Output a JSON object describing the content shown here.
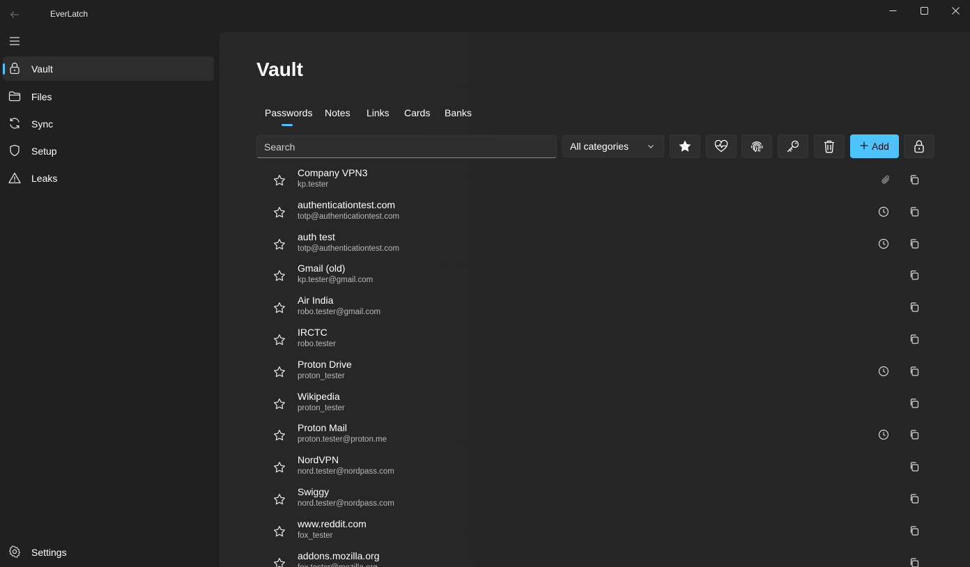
{
  "app": {
    "title": "EverLatch"
  },
  "sidebar": {
    "items": [
      {
        "label": "Vault",
        "icon": "lock-icon",
        "active": true
      },
      {
        "label": "Files",
        "icon": "folder-icon",
        "active": false
      },
      {
        "label": "Sync",
        "icon": "sync-icon",
        "active": false
      },
      {
        "label": "Setup",
        "icon": "shield-icon",
        "active": false
      },
      {
        "label": "Leaks",
        "icon": "warning-icon",
        "active": false
      }
    ],
    "settings": {
      "label": "Settings",
      "icon": "gear-icon"
    }
  },
  "main": {
    "title": "Vault",
    "tabs": [
      "Passwords",
      "Notes",
      "Links",
      "Cards",
      "Banks"
    ],
    "active_tab": "Passwords"
  },
  "toolbar": {
    "search_placeholder": "Search",
    "category": "All categories",
    "add_label": "Add",
    "buttons": [
      "favorites-star-icon",
      "health-heart-icon",
      "fingerprint-icon",
      "key-icon",
      "trash-icon",
      "lock-icon"
    ]
  },
  "entries": [
    {
      "title": "Company VPN3",
      "subtitle": "kp.tester",
      "has_totp": false,
      "has_attachment": true
    },
    {
      "title": "authenticationtest.com",
      "subtitle": "totp@authenticationtest.com",
      "has_totp": true,
      "has_attachment": false
    },
    {
      "title": "auth test",
      "subtitle": "totp@authenticationtest.com",
      "has_totp": true,
      "has_attachment": false
    },
    {
      "title": "Gmail (old)",
      "subtitle": "kp.tester@gmail.com",
      "has_totp": false,
      "has_attachment": false
    },
    {
      "title": "Air India",
      "subtitle": "robo.tester@gmail.com",
      "has_totp": false,
      "has_attachment": false
    },
    {
      "title": "IRCTC",
      "subtitle": "robo.tester",
      "has_totp": false,
      "has_attachment": false
    },
    {
      "title": "Proton Drive",
      "subtitle": "proton_tester",
      "has_totp": true,
      "has_attachment": false
    },
    {
      "title": "Wikipedia",
      "subtitle": "proton_tester",
      "has_totp": false,
      "has_attachment": false
    },
    {
      "title": "Proton Mail",
      "subtitle": "proton.tester@proton.me",
      "has_totp": true,
      "has_attachment": false
    },
    {
      "title": "NordVPN",
      "subtitle": "nord.tester@nordpass.com",
      "has_totp": false,
      "has_attachment": false
    },
    {
      "title": "Swiggy",
      "subtitle": "nord.tester@nordpass.com",
      "has_totp": false,
      "has_attachment": false
    },
    {
      "title": "www.reddit.com",
      "subtitle": "fox_tester",
      "has_totp": false,
      "has_attachment": false
    },
    {
      "title": "addons.mozilla.org",
      "subtitle": "fox.tester@mozilla.org",
      "has_totp": false,
      "has_attachment": false
    }
  ],
  "colors": {
    "accent": "#4cc2ff",
    "background": "#202020",
    "surface": "#272727"
  }
}
